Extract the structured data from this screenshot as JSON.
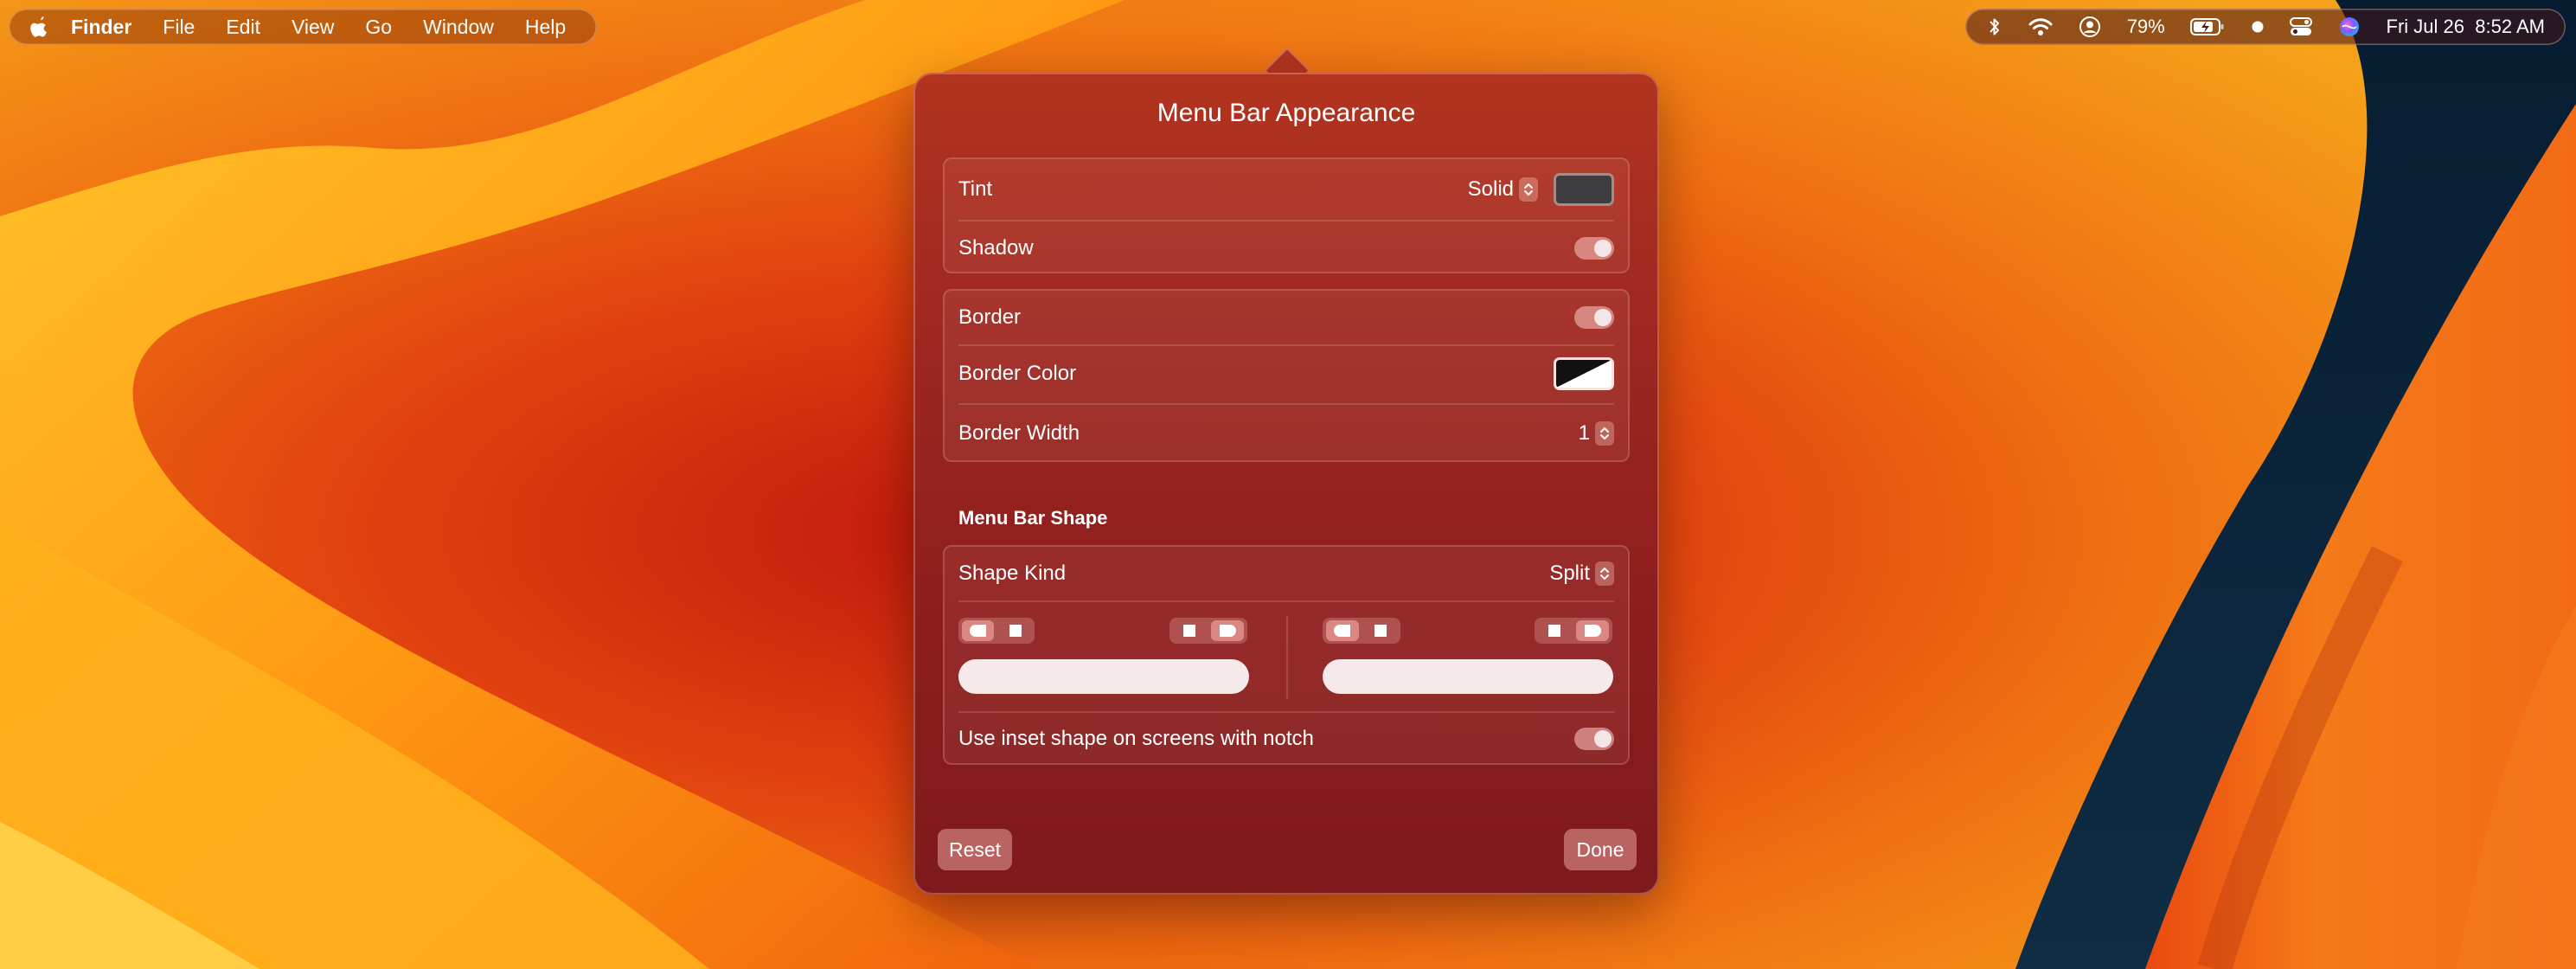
{
  "menubar": {
    "app_name": "Finder",
    "menus": [
      "File",
      "Edit",
      "View",
      "Go",
      "Window",
      "Help"
    ],
    "status": {
      "battery_percent": "79%",
      "clock": "Fri Jul 26  8:52 AM"
    }
  },
  "dialog": {
    "title": "Menu Bar Appearance",
    "tint": {
      "label": "Tint",
      "value": "Solid",
      "color": "#3d3d3f"
    },
    "shadow": {
      "label": "Shadow",
      "enabled": true
    },
    "border": {
      "label": "Border",
      "enabled": true
    },
    "border_color": {
      "label": "Border Color"
    },
    "border_width": {
      "label": "Border Width",
      "value": "1"
    },
    "shape_section": {
      "heading": "Menu Bar Shape",
      "shape_kind": {
        "label": "Shape Kind",
        "value": "Split"
      },
      "notch": {
        "label": "Use inset shape on screens with notch",
        "enabled": true
      }
    },
    "buttons": {
      "reset": "Reset",
      "done": "Done"
    }
  },
  "colors": {
    "accent_toggle": "#e6a8a8",
    "popover_bg": "#9c2620"
  }
}
